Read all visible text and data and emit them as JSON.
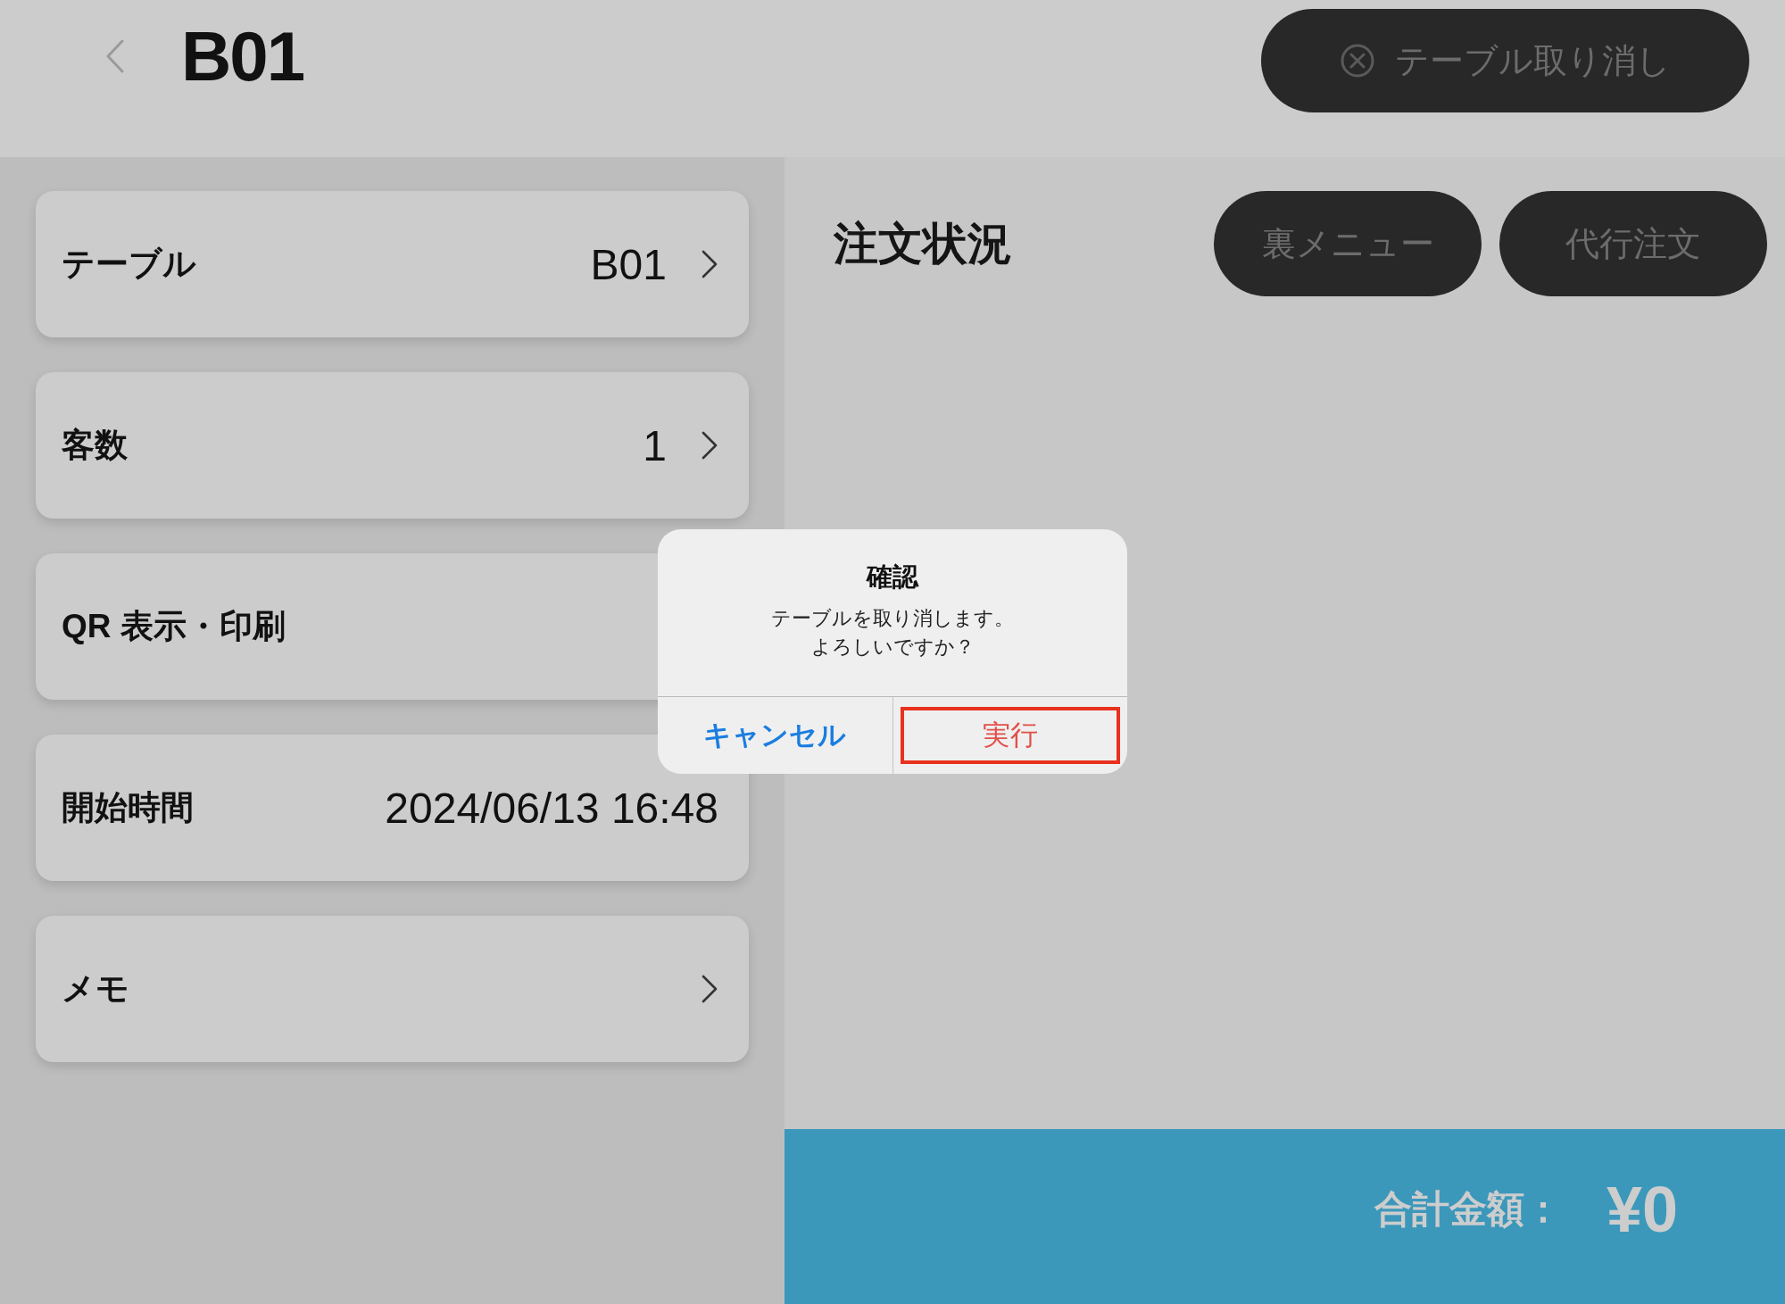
{
  "header": {
    "title": "B01",
    "cancel_button": {
      "label": "テーブル取り消し"
    }
  },
  "info_rows": [
    {
      "label": "テーブル",
      "value": "B01",
      "chevron": true
    },
    {
      "label": "客数",
      "value": "1",
      "chevron": true
    },
    {
      "label": "QR 表示・印刷",
      "chevron": false
    },
    {
      "label": "開始時間",
      "value": "2024/06/13 16:48",
      "chevron": false
    },
    {
      "label": "メモ",
      "chevron": true
    }
  ],
  "orders": {
    "title": "注文状況",
    "buttons": [
      {
        "label": "裏メニュー"
      },
      {
        "label": "代行注文"
      }
    ]
  },
  "total": {
    "label": "合計金額：",
    "amount": "¥0"
  },
  "dialog": {
    "title": "確認",
    "message_lines": [
      "テーブルを取り消します。",
      "よろしいですか？"
    ],
    "actions": [
      {
        "label": "キャンセル",
        "kind": "cancel",
        "highlighted": false
      },
      {
        "label": "実行",
        "kind": "destructive",
        "highlighted": true
      }
    ]
  }
}
